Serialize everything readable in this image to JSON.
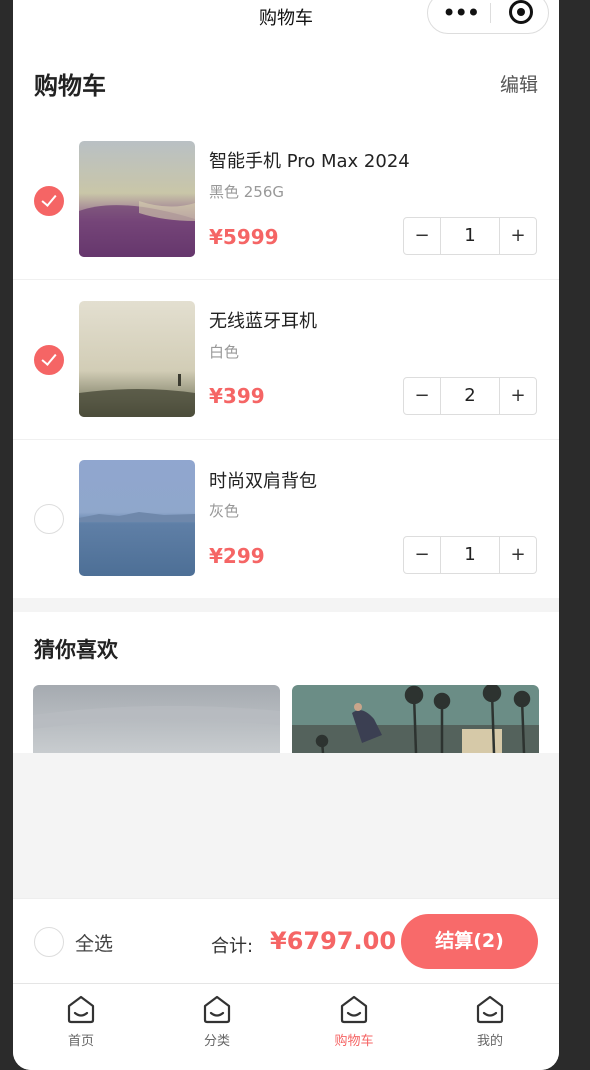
{
  "navbar": {
    "title": "购物车",
    "more_icon": "more-dots-icon",
    "target_icon": "record-target-icon"
  },
  "page": {
    "title": "购物车",
    "edit_label": "编辑"
  },
  "cart": {
    "items": [
      {
        "name": "智能手机 Pro Max 2024",
        "spec": "黑色 256G",
        "price": "¥5999",
        "quantity": "1",
        "checked": true
      },
      {
        "name": "无线蓝牙耳机",
        "spec": "白色",
        "price": "¥399",
        "quantity": "2",
        "checked": true
      },
      {
        "name": "时尚双肩背包",
        "spec": "灰色",
        "price": "¥299",
        "quantity": "1",
        "checked": false
      }
    ],
    "minus_label": "−",
    "plus_label": "+"
  },
  "recommend": {
    "title": "猜你喜欢"
  },
  "checkout": {
    "select_all_label": "全选",
    "total_label": "合计:",
    "total_value": "¥6797.00",
    "button_label": "结算(2)"
  },
  "tabbar": {
    "tabs": [
      {
        "label": "首页",
        "icon": "home-icon",
        "active": false
      },
      {
        "label": "分类",
        "icon": "home-icon",
        "active": false
      },
      {
        "label": "购物车",
        "icon": "home-icon",
        "active": true
      },
      {
        "label": "我的",
        "icon": "home-icon",
        "active": false
      }
    ]
  },
  "colors": {
    "accent": "#f56565",
    "checkout_button": "#f86a6a",
    "background_grey": "#f4f4f4"
  }
}
